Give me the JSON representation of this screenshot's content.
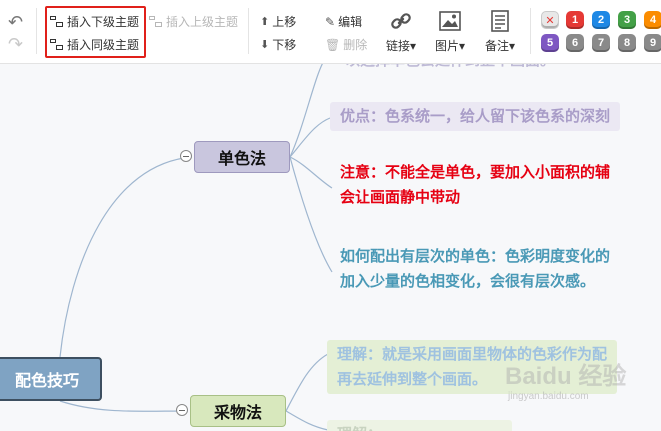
{
  "toolbar": {
    "undo_icon": "undo-icon",
    "redo_icon": "redo-icon",
    "insert_child": "插入下级主题",
    "insert_parent": "插入上级主题",
    "insert_sibling": "插入同级主题",
    "move_up": "上移",
    "move_down": "下移",
    "edit": "编辑",
    "delete": "删除",
    "link": "链接",
    "image": "图片",
    "note": "备注",
    "dropdown_glyph": "▾",
    "priority": {
      "clear": "✕",
      "levels": [
        "1",
        "2",
        "3",
        "4",
        "5",
        "6",
        "7",
        "8",
        "9"
      ],
      "colors": {
        "clear": "#e8e8e8",
        "1": "#e53935",
        "2": "#1e88e5",
        "3": "#43a047",
        "4": "#fb8c00",
        "5": "#7e57c2",
        "6": "#8a8a8a",
        "7": "#8a8a8a",
        "8": "#8a8a8a",
        "9": "#8a8a8a"
      }
    },
    "highlight_color": "#e0201a"
  },
  "mindmap": {
    "root": "配色技巧",
    "topics": {
      "mono": "单色法",
      "real": "采物法"
    },
    "leaves": {
      "cut_top": "以选择单色去延伸到整个画面。",
      "advantage": "优点：色系统一，给人留下该色系的深刻",
      "note_line1": "注意：不能全是单色，要加入小面积的辅",
      "note_line2": "会让画面静中带动",
      "how_line1": "如何配出有层次的单色：色彩明度变化的",
      "how_line2": "加入少量的色相变化，会很有层次感。",
      "understand_line1": "理解：就是采用画面里物体的色彩作为配",
      "understand_line2": "再去延伸到整个画面。",
      "cut_bottom": "理解：……………………"
    }
  },
  "watermark": {
    "brand": "Baidu 经验",
    "url": "jingyan.baidu.com"
  }
}
